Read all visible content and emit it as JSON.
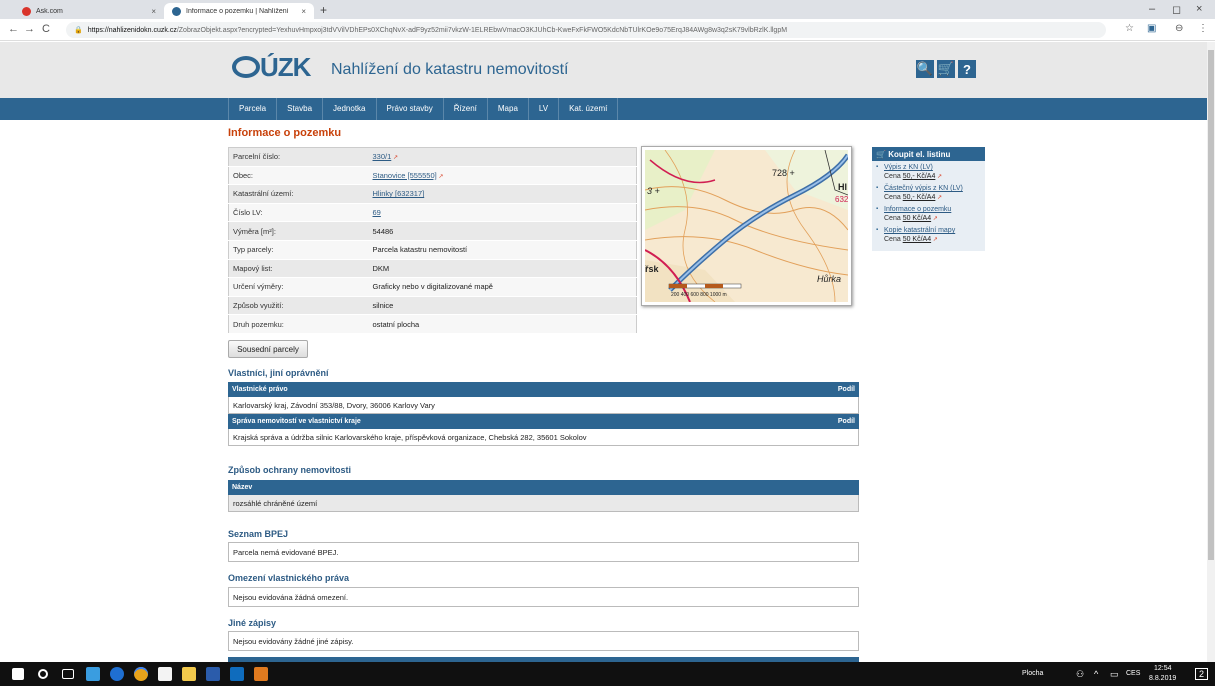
{
  "browser": {
    "tabs": [
      {
        "title": "Ask.com",
        "close": "×"
      },
      {
        "title": "Informace o pozemku | Nahlížení",
        "close": "×"
      }
    ],
    "new_tab": "+",
    "window_controls": {
      "min": "–",
      "max": "◻",
      "close": "×"
    },
    "nav": {
      "back": "←",
      "forward": "→",
      "reload": "C"
    },
    "url": {
      "lock": "🔒",
      "host": "https://nahlizenidokn.cuzk.cz",
      "path": "/ZobrazObjekt.aspx?encrypted=YexhuvHmpxoj3tdVVilVDhEPs0XChqNvX-adF9yz52mii7vkzW-1ELREbwVmacO3KJUhCb-KweFxFkFWO5KdcNbTUlrKOe9o75ErqJ84AWg8w3q2sK79vlbRzlK.llgpM"
    },
    "tools": {
      "star": "☆",
      "ext": "▣",
      "account": "⊖",
      "menu": "⋮"
    }
  },
  "header": {
    "logo": "ÚZK",
    "title": "Nahlížení do katastru nemovitostí",
    "icons": [
      "search-icon",
      "cart-icon",
      "help-icon"
    ],
    "icon_glyphs": [
      "🔍",
      "🛒",
      "?"
    ]
  },
  "menu": [
    "Parcela",
    "Stavba",
    "Jednotka",
    "Právo stavby",
    "Řízení",
    "Mapa",
    "LV",
    "Kat. území"
  ],
  "main": {
    "title": "Informace o pozemku",
    "info": [
      {
        "label": "Parcelní číslo:",
        "value": "330/1",
        "link": true
      },
      {
        "label": "Obec:",
        "value": "Stanovice [555550]",
        "link": true
      },
      {
        "label": "Katastrální území:",
        "value": "Hlinky [632317]",
        "link": true
      },
      {
        "label": "Číslo LV:",
        "value": "69",
        "link": true
      },
      {
        "label": "Výměra [m²]:",
        "value": "54486",
        "link": false
      },
      {
        "label": "Typ parcely:",
        "value": "Parcela katastru nemovitostí",
        "link": false
      },
      {
        "label": "Mapový list:",
        "value": "DKM",
        "link": false
      },
      {
        "label": "Určení výměry:",
        "value": "Graficky nebo v digitalizované mapě",
        "link": false
      },
      {
        "label": "Způsob využití:",
        "value": "silnice",
        "link": false
      },
      {
        "label": "Druh pozemku:",
        "value": "ostatní plocha",
        "link": false
      }
    ],
    "map_labels": {
      "n728": "728 +",
      "n3": "3 +",
      "hl": "Hl",
      "n632": "632",
      "hurka": "Hůrka",
      "rsk": "řsk",
      "scale": "200  400  600  800 1000 m"
    },
    "neighbors_button": "Sousední parcely"
  },
  "owners": {
    "title": "Vlastníci, jiní oprávnění",
    "h1": "Vlastnické právo",
    "h1_share": "Podíl",
    "r1": "Karlovarský kraj, Závodní 353/88, Dvory, 36006 Karlovy Vary",
    "h2": "Správa nemovitostí ve vlastnictví kraje",
    "h2_share": "Podíl",
    "r2": "Krajská správa a údržba silnic Karlovarského kraje, příspěvková organizace, Chebská 282, 35601 Sokolov"
  },
  "protection": {
    "title": "Způsob ochrany nemovitosti",
    "h": "Název",
    "r": "rozsáhlé chráněné území"
  },
  "bpej": {
    "title": "Seznam BPEJ",
    "text": "Parcela nemá evidované BPEJ."
  },
  "restriction": {
    "title": "Omezení vlastnického práva",
    "text": "Nejsou evidována žádná omezení."
  },
  "other": {
    "title": "Jiné zápisy",
    "text": "Nejsou evidovány žádné jiné zápisy."
  },
  "buy": {
    "title": "Koupit el. listinu",
    "items": [
      {
        "link": "Výpis z KN (LV)",
        "price_label": "Cena",
        "price": "50,- Kč/A4"
      },
      {
        "link": "Částečný výpis z KN (LV)",
        "price_label": "Cena",
        "price": "50,- Kč/A4"
      },
      {
        "link": "Informace o pozemku",
        "price_label": "Cena",
        "price": "50 Kč/A4"
      },
      {
        "link": "Kopie katastrální mapy",
        "price_label": "Cena",
        "price": "50 Kč/A4"
      }
    ]
  },
  "taskbar": {
    "desktop": "Plocha",
    "lang": "CES",
    "time": "12:54",
    "date": "8.8.2019",
    "notif": "2"
  },
  "colors": {
    "brand": "#2d6591",
    "title_red": "#c8410a",
    "link": "#2d5b84"
  }
}
